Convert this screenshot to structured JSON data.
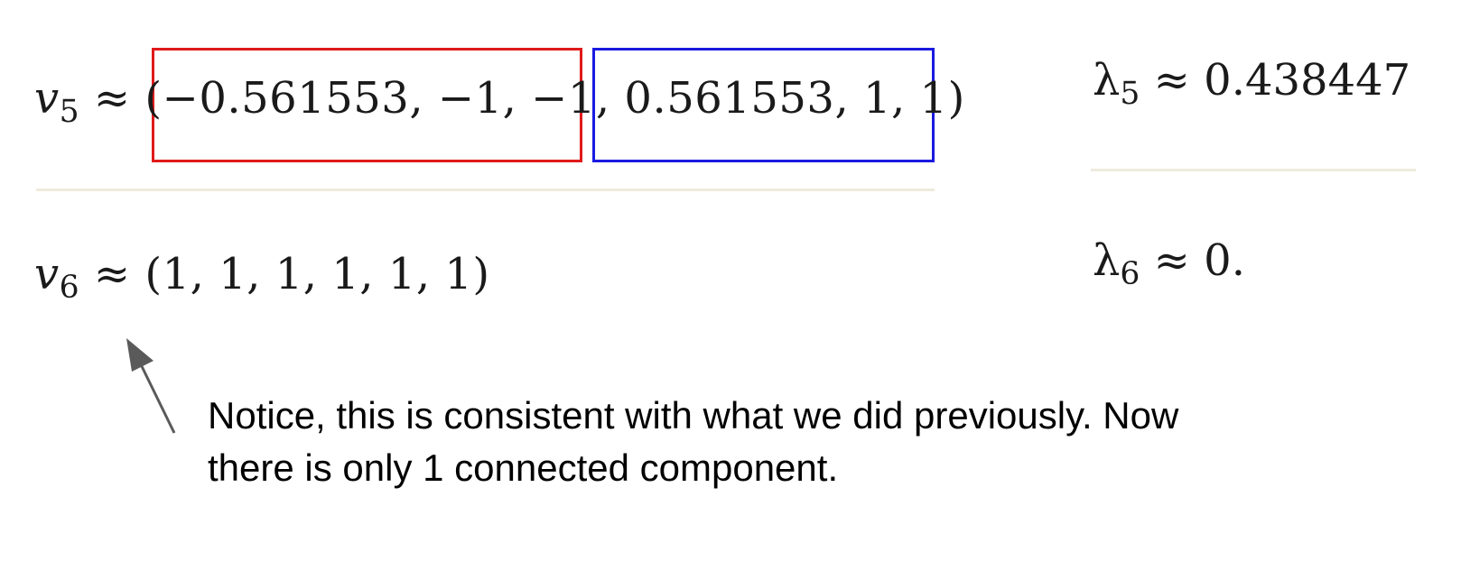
{
  "eigenvectors": {
    "v5": {
      "symbol": "v",
      "subscript": "5",
      "relation": "≈",
      "open_paren": "(",
      "first_half": "−0.561553, −1, −1,",
      "second_half": "0.561553, 1, 1)"
    },
    "v6": {
      "symbol": "v",
      "subscript": "6",
      "relation": "≈",
      "value": "(1, 1, 1, 1, 1, 1)"
    }
  },
  "eigenvalues": {
    "l5": {
      "symbol": "λ",
      "subscript": "5",
      "relation": "≈",
      "value": "0.438447"
    },
    "l6": {
      "symbol": "λ",
      "subscript": "6",
      "relation": "≈",
      "value": "0."
    }
  },
  "annotation": {
    "line1": "Notice, this is consistent with what we did previously. Now",
    "line2": "there is only 1 connected component."
  },
  "colors": {
    "highlight_first_half": "#e01a1a",
    "highlight_second_half": "#1a1ae0",
    "arrow": "#5a5a5a"
  }
}
